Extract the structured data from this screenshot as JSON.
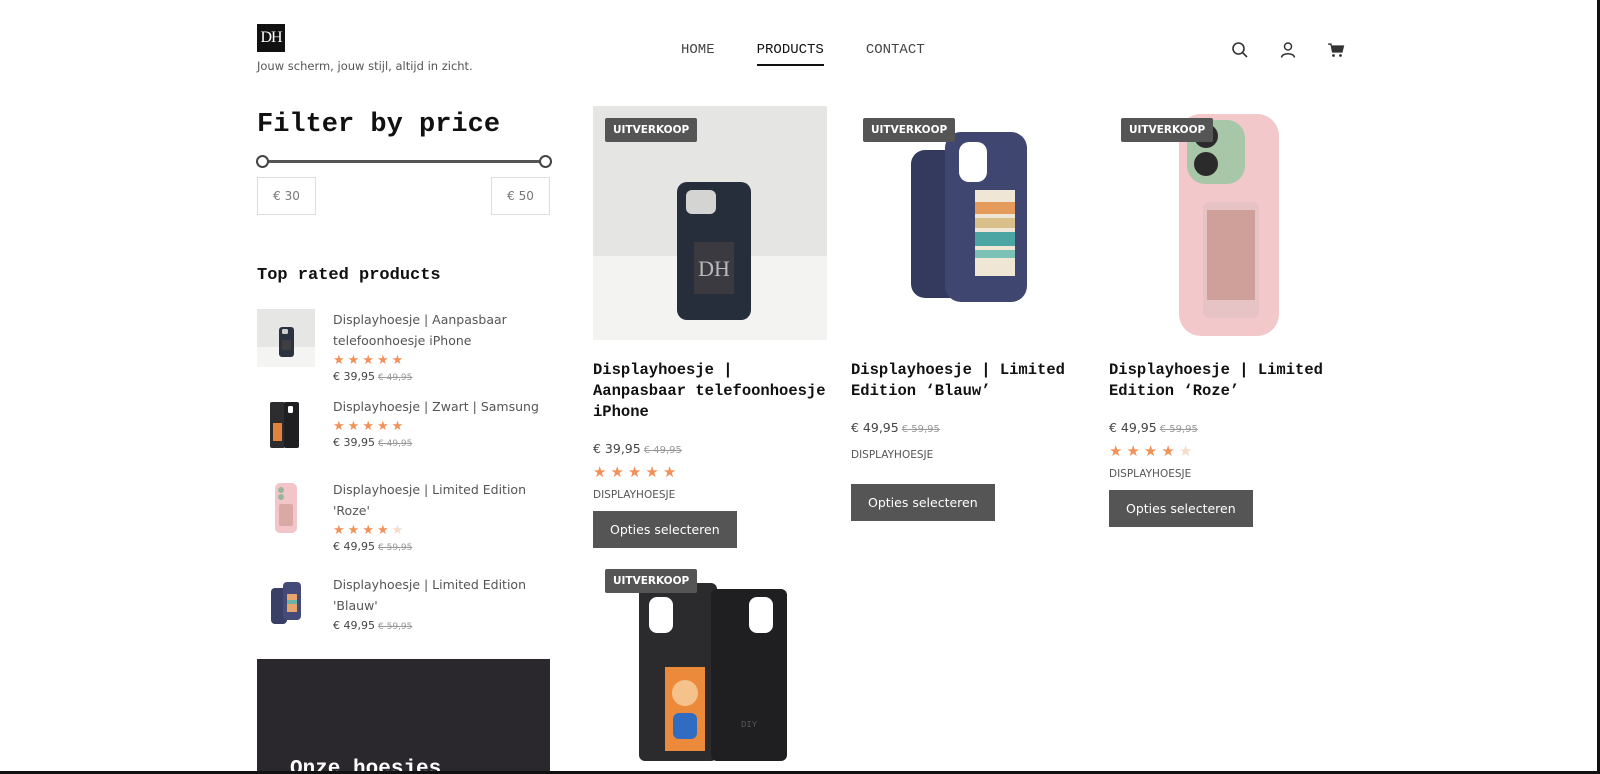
{
  "header": {
    "logo_text": "DH",
    "tagline": "Jouw scherm, jouw stijl, altijd in zicht.",
    "nav": [
      "HOME",
      "PRODUCTS",
      "CONTACT"
    ],
    "active_nav": "PRODUCTS",
    "icons": [
      "search-icon",
      "account-icon",
      "cart-icon"
    ]
  },
  "sidebar": {
    "filter_title": "Filter by price",
    "price_min": "€ 30",
    "price_max": "€ 50",
    "top_rated_title": "Top rated products",
    "top_rated": [
      {
        "name": "Displayhoesje | Aanpasbaar telefoonhoesje iPhone",
        "rating": 5,
        "price": "€ 39,95",
        "old_price": "€ 49,95"
      },
      {
        "name": "Displayhoesje | Zwart | Samsung",
        "rating": 5,
        "price": "€ 39,95",
        "old_price": "€ 49,95"
      },
      {
        "name": "Displayhoesje | Limited Edition 'Roze'",
        "rating": 4,
        "price": "€ 49,95",
        "old_price": "€ 59,95"
      },
      {
        "name": "Displayhoesje | Limited Edition 'Blauw'",
        "rating": 0,
        "price": "€ 49,95",
        "old_price": "€ 59,95"
      }
    ],
    "promo_title": "Onze hoesjes"
  },
  "products": [
    {
      "badge": "UITVERKOOP",
      "title": "Displayhoesje | Aanpasbaar telefoonhoesje iPhone",
      "price": "€ 39,95",
      "old_price": "€ 49,95",
      "rating": 5,
      "category": "DISPLAYHOESJE",
      "button": "Opties selecteren"
    },
    {
      "badge": "UITVERKOOP",
      "title": "Displayhoesje | Limited Edition ‘Blauw’",
      "price": "€ 49,95",
      "old_price": "€ 59,95",
      "rating": 0,
      "category": "DISPLAYHOESJE",
      "button": "Opties selecteren"
    },
    {
      "badge": "UITVERKOOP",
      "title": "Displayhoesje | Limited Edition ‘Roze’",
      "price": "€ 49,95",
      "old_price": "€ 59,95",
      "rating": 4,
      "category": "DISPLAYHOESJE",
      "button": "Opties selecteren"
    },
    {
      "badge": "UITVERKOOP"
    }
  ],
  "colors": {
    "accent_star": "#f0915a",
    "button": "#555555",
    "dark_panel": "#2a282c"
  }
}
